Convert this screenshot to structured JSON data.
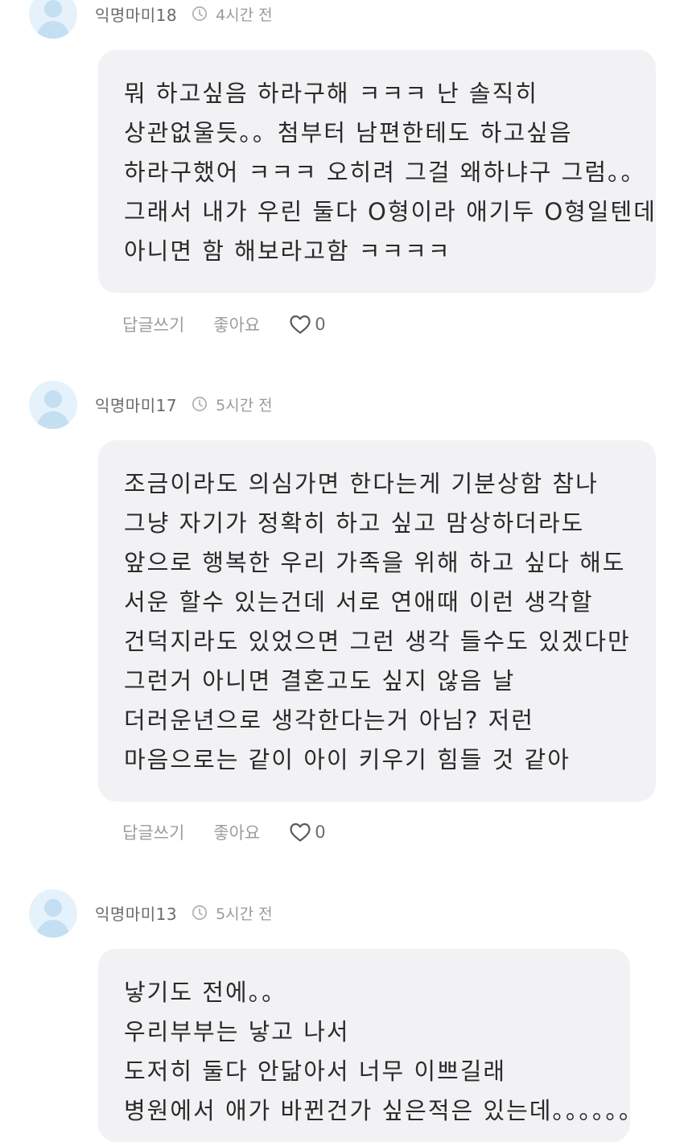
{
  "comments": [
    {
      "author": "익명마미18",
      "time": "4시간 전",
      "lines": [
        "뭐 하고싶음 하라구해 ㅋㅋㅋ 난 솔직히",
        "상관없울듯。。첨부터 남편한테도 하고싶음",
        "하라구했어 ㅋㅋㅋ 오히려 그걸 왜하냐구 그럼。。",
        "그래서 내가 우린 둘다 O형이라 애기두 O형일텐데",
        "아니면 함 해보라고함 ㅋㅋㅋㅋ"
      ],
      "reply_label": "답글쓰기",
      "like_label": "좋아요",
      "like_count": "0"
    },
    {
      "author": "익명마미17",
      "time": "5시간 전",
      "lines": [
        "조금이라도 의심가면 한다는게 기분상함 참나",
        "그냥 자기가 정확히 하고 싶고 맘상하더라도",
        "앞으로 행복한 우리 가족을 위해 하고 싶다 해도",
        "서운 할수 있는건데 서로 연애때 이런 생각할",
        "건덕지라도 있었으면 그런 생각 들수도 있겠다만",
        "그런거 아니면 결혼고도 싶지 않음 날",
        "더러운년으로 생각한다는거 아님? 저런",
        "마음으로는 같이 아이 키우기 힘들 것 같아"
      ],
      "reply_label": "답글쓰기",
      "like_label": "좋아요",
      "like_count": "0"
    },
    {
      "author": "익명마미13",
      "time": "5시간 전",
      "lines": [
        "낳기도 전에。。",
        "우리부부는 낳고 나서",
        "도저히 둘다 안닮아서 너무 이쁘길래",
        "병원에서 애가 바뀐건가 싶은적은 있는데。。。。。。"
      ]
    }
  ]
}
